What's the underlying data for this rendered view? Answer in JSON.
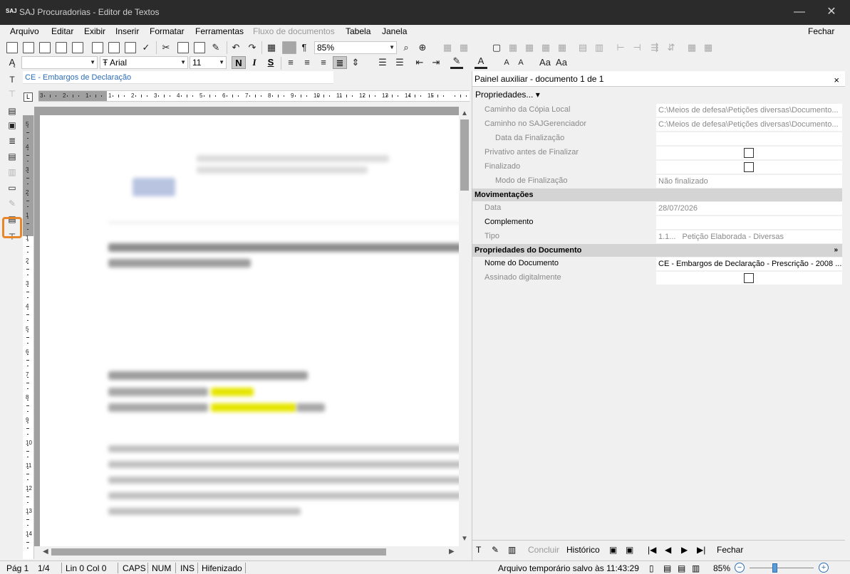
{
  "window": {
    "logo_text": "SAJ",
    "title": "SAJ Procuradorias - Editor de Textos",
    "minimize_glyph": "—",
    "close_glyph": "✕"
  },
  "menu": {
    "items": [
      "Arquivo",
      "Editar",
      "Exibir",
      "Inserir",
      "Formatar",
      "Ferramentas",
      "Fluxo de documentos",
      "Tabela",
      "Janela"
    ],
    "right": "Fechar"
  },
  "toolbar": {
    "style_value": "",
    "font_value": "Arial",
    "font_prefix": "Ŧ",
    "size_value": "11",
    "zoom_value": "85%",
    "bold_label": "N",
    "italic_label": "I",
    "strike_label": "S",
    "pilcrow": "¶",
    "accent_highlight": "#e8e800",
    "accent_fontcolor": "#000000"
  },
  "document": {
    "tab_title": "CE - Embargos de Declaração",
    "ruler_h": [
      "3",
      "2",
      "1",
      "1",
      "2",
      "3",
      "4",
      "5",
      "6",
      "7",
      "8",
      "9",
      "10",
      "11",
      "12",
      "13",
      "14",
      "15"
    ],
    "ruler_v": [
      "5",
      "4",
      "3",
      "2",
      "1",
      "1",
      "2",
      "3",
      "4",
      "5",
      "6",
      "7",
      "8",
      "9",
      "10",
      "11",
      "12",
      "13",
      "14"
    ]
  },
  "panel": {
    "title": "Painel auxiliar - documento 1 de 1",
    "close": "×",
    "tab": "Propriedades... ▾",
    "rows": [
      {
        "label": "Caminho da Cópia Local",
        "value": "C:\\Meios de defesa\\Petições diversas\\Documento..."
      },
      {
        "label": "Caminho no SAJGerenciador",
        "value": "C:\\Meios de defesa\\Petições diversas\\Documento..."
      },
      {
        "label": "Data da Finalização",
        "value": ""
      },
      {
        "label": "Privativo antes de Finalizar",
        "value": ""
      },
      {
        "label": "Finalizado",
        "value": ""
      },
      {
        "label": "Modo de Finalização",
        "value": "Não finalizado"
      }
    ],
    "section_mov": "Movimentações",
    "mov_rows": [
      {
        "label": "Data",
        "value": "28/07/2026"
      },
      {
        "label": "Complemento",
        "value": ""
      },
      {
        "label": "Tipo",
        "value": "1.1...",
        "value2": "Petição Elaborada - Diversas"
      }
    ],
    "section_doc": "Propriedades do Documento",
    "section_doc_toggle": "»",
    "doc_rows": [
      {
        "label": "Nome do Documento",
        "value": "CE - Embargos de Declaração - Prescrição - 2008 ..."
      },
      {
        "label": "Assinado digitalmente",
        "value": ""
      }
    ],
    "footer": {
      "conclude": "Concluir",
      "history": "Histórico",
      "close": "Fechar"
    }
  },
  "status": {
    "page": "Pág 1",
    "pages": "1/4",
    "lincol": "Lin 0  Col 0",
    "caps": "CAPS",
    "num": "NUM",
    "ins": "INS",
    "hyph": "Hifenizado",
    "saved": "Arquivo temporário salvo às 11:43:29",
    "zoom": "85%"
  }
}
